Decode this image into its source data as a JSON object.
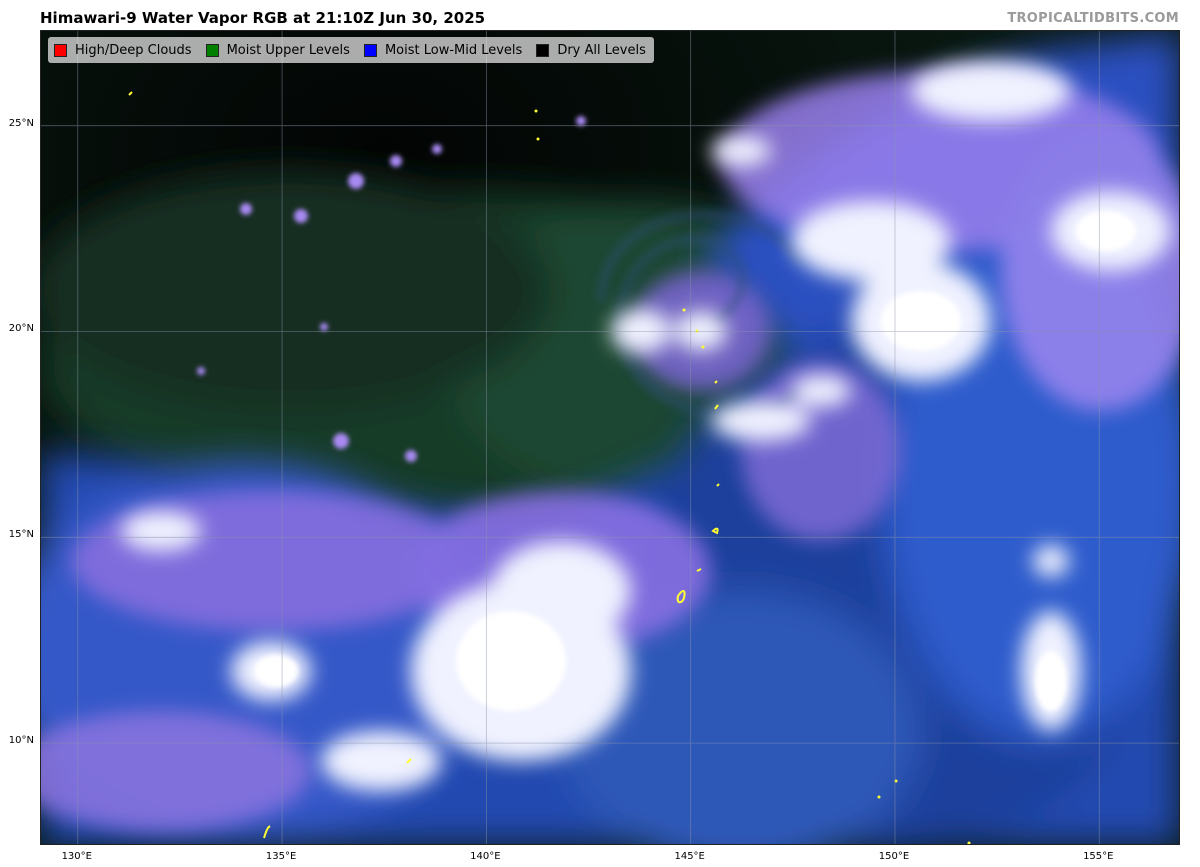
{
  "title": "Himawari-9 Water Vapor RGB at 21:10Z Jun 30, 2025",
  "site": "TROPICALTIDBITS.COM",
  "legend": [
    {
      "label": "High/Deep Clouds",
      "color": "#ff0000"
    },
    {
      "label": "Moist Upper Levels",
      "color": "#008000"
    },
    {
      "label": "Moist Low-Mid Levels",
      "color": "#0000ff"
    },
    {
      "label": "Dry All Levels",
      "color": "#000000"
    }
  ],
  "axes": {
    "lat_ticks": [
      "25°N",
      "20°N",
      "15°N",
      "10°N"
    ],
    "lon_ticks": [
      "130°E",
      "135°E",
      "140°E",
      "145°E",
      "150°E",
      "155°E"
    ],
    "lat_range": [
      7.5,
      27.3
    ],
    "lon_range": [
      129.1,
      157.0
    ],
    "grid": true
  },
  "colors": {
    "dry": "#050c08",
    "moist_upper": "#1c3e2c",
    "moist_low_mid": "#2a55c8",
    "high_clouds": "#f2f4ff",
    "transition": "#9a7ce8",
    "coastline": "#ffff33"
  }
}
